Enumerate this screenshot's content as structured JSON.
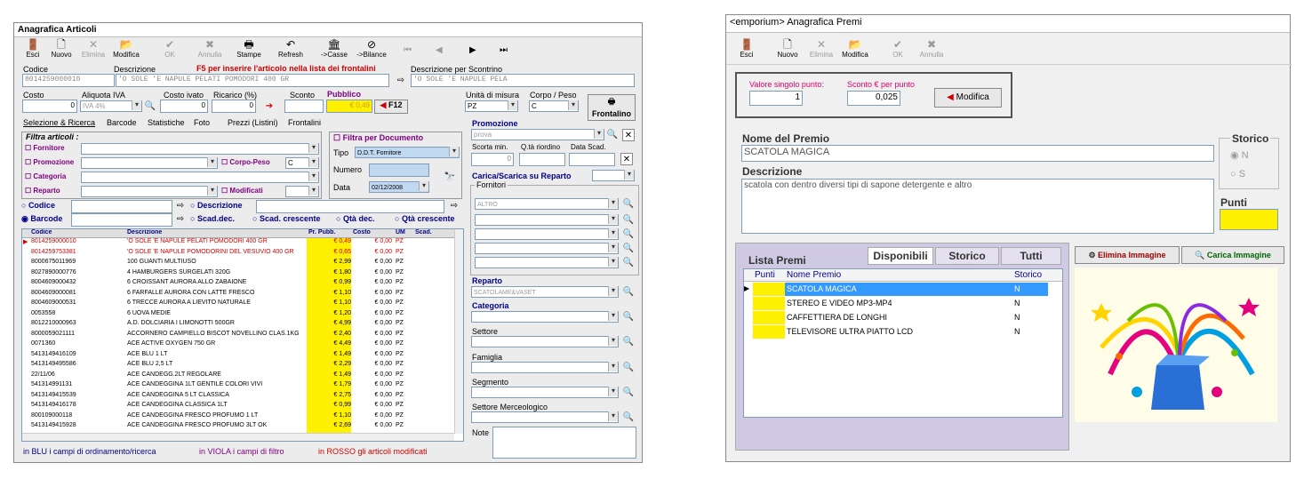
{
  "left": {
    "title": "Anagrafica Articoli",
    "toolbar": [
      "Esci",
      "Nuovo",
      "Elimina",
      "Modifica",
      "OK",
      "Annulla",
      "Stampe",
      "Refresh",
      "->Casse",
      "->Bilance"
    ],
    "codice_label": "Codice",
    "codice_value": "8014259000010",
    "descrizione_label": "Descrizione",
    "descrizione_value": "'O SOLE 'E NAPULE PELATI POMODORI 400 GR",
    "f5_hint": "F5 per inserire l'articolo nella lista dei frontalini",
    "scontrino_label": "Descrizione per Scontrino",
    "scontrino_value": "'O SOLE 'E NAPULE PELA",
    "costo_label": "Costo",
    "costo_value": "0",
    "aliquota_label": "Aliquota IVA",
    "aliquota_value": "IVA 4%",
    "costo_ivato_label": "Costo ivato",
    "costo_ivato_value": "0",
    "ricarico_label": "Ricarico (%)",
    "ricarico_value": "0",
    "sconto_label": "Sconto",
    "pubblico_label": "Pubblico",
    "pubblico_value": "€ 0,49",
    "f12": "F12",
    "unita_label": "Unità di misura",
    "unita_value": "PZ",
    "corpo_label": "Corpo / Peso",
    "corpo_value": "C",
    "frontalino": "Frontalino",
    "tabs": [
      "Selezione & Ricerca",
      "Barcode",
      "Statistiche",
      "Foto",
      "Prezzi (Listini)",
      "Frontalini"
    ],
    "filtra_title": "Filtra articoli :",
    "filters": [
      "Fornitore",
      "Promozione",
      "Categoria",
      "Reparto"
    ],
    "corpo_peso_chk": "Corpo-Peso",
    "corpo_peso_val": "C",
    "modificati_chk": "Modificati",
    "filtra_doc": "Filtra per Documento",
    "tipo_label": "Tipo",
    "tipo_value": "D.D.T. Fornitore",
    "numero_label": "Numero",
    "data_label": "Data",
    "data_value": "02/12/2008",
    "radio_codice": "Codice",
    "radio_descrizione": "Descrizione",
    "radio_barcode": "Barcode",
    "sort_options": [
      "Scad.dec.",
      "Scad. crescente",
      "Qtà dec.",
      "Qtà crescente"
    ],
    "grid_headers": [
      "Codice",
      "Descrizione",
      "Pr. Pubb.",
      "Costo",
      "UM",
      "Scad."
    ],
    "grid_rows": [
      [
        "8014259000010",
        "'O SOLE 'E NAPULE PELATI POMODORI 400 GR",
        "€ 0,49",
        "€ 0,00",
        "PZ"
      ],
      [
        "8014259753381",
        "'O SOLE 'E NAPULE POMODORINI DEL VESUVIO 400 GR",
        "€ 0,65",
        "€ 0,00",
        "PZ"
      ],
      [
        "8000675011969",
        "100 GUANTI MULTIUSO",
        "€ 2,99",
        "€ 0,00",
        "PZ"
      ],
      [
        "8027890000776",
        "4 HAMBURGERS SURGELATI 320G",
        "€ 1,80",
        "€ 0,00",
        "PZ"
      ],
      [
        "8004609000432",
        "6 CROISSANT AURORA ALLO ZABAIONE",
        "€ 0,99",
        "€ 0,00",
        "PZ"
      ],
      [
        "8004609000081",
        "6 FARFALLE AURORA CON LATTE FRESCO",
        "€ 1,10",
        "€ 0,00",
        "PZ"
      ],
      [
        "8004609000531",
        "6 TRECCE AURORA A LIEVITO NATURALE",
        "€ 1,10",
        "€ 0,00",
        "PZ"
      ],
      [
        "0053558",
        "6 UOVA MEDIE",
        "€ 1,20",
        "€ 0,00",
        "PZ"
      ],
      [
        "8012210000963",
        "A.D. DOLCIARIA I LIMONOTTI 500GR",
        "€ 4,99",
        "€ 0,00",
        "PZ"
      ],
      [
        "8000059021111",
        "ACCORNERO CAMPIELLO BISCOT NOVELLINO CLAS.1KG",
        "€ 2,40",
        "€ 0,00",
        "PZ"
      ],
      [
        "0071360",
        "ACE ACTIVE OXYGEN 750 GR",
        "€ 4,49",
        "€ 0,00",
        "PZ"
      ],
      [
        "5413149416109",
        "ACE BLU 1 LT",
        "€ 1,49",
        "€ 0,00",
        "PZ"
      ],
      [
        "5413149495586",
        "ACE BLU 2,5 LT",
        "€ 2,29",
        "€ 0,00",
        "PZ"
      ],
      [
        "22/11/06",
        "ACE CANDEGG.2LT REGOLARE",
        "€ 1,49",
        "€ 0,00",
        "PZ"
      ],
      [
        "541314991131",
        "ACE CANDEGGINA 1LT GENTILE COLORI VIVI",
        "€ 1,79",
        "€ 0,00",
        "PZ"
      ],
      [
        "5413149415539",
        "ACE CANDEGGINA 5 LT CLASSICA",
        "€ 2,75",
        "€ 0,00",
        "PZ"
      ],
      [
        "5413149416178",
        "ACE CANDEGGINA CLASSICA 1LT",
        "€ 0,99",
        "€ 0,00",
        "PZ"
      ],
      [
        "800109000118",
        "ACE CANDEGGINA FRESCO PROFUMO 1 LT",
        "€ 1,10",
        "€ 0,00",
        "PZ"
      ],
      [
        "5413149415928",
        "ACE CANDEGGINA FRESCO PROFUMO 3LT OK",
        "€ 2,69",
        "€ 0,00",
        "PZ"
      ]
    ],
    "promozione_label": "Promozione",
    "promozione_value": "prova",
    "scorta_label": "Scorta min.",
    "qta_label": "Q.tà riordino",
    "data_scad_label": "Data Scad.",
    "scorta_value": "0",
    "carica_label": "Carica/Scarica su Reparto",
    "fornitori_label": "Fornitori",
    "fornitore1": "ALTRO",
    "reparto_label": "Reparto",
    "reparto_value": "SCATOLAME&VASET",
    "categoria_label": "Categoria",
    "settore_label": "Settore",
    "famiglia_label": "Famiglia",
    "segmento_label": "Segmento",
    "settore_merc_label": "Settore Merceologico",
    "note_label": "Note",
    "footer_blue": "in BLU i campi di ordinamento/ricerca",
    "footer_purple": "in VIOLA i campi di filtro",
    "footer_red": "in ROSSO gli articoli modificati"
  },
  "right": {
    "title": "<emporium> Anagrafica Premi",
    "toolbar": [
      "Esci",
      "Nuovo",
      "Elimina",
      "Modifica",
      "OK",
      "Annulla"
    ],
    "valore_label": "Valore singolo punto:",
    "valore_value": "1",
    "sconto_label": "Sconto € per punto",
    "sconto_value": "0,025",
    "modifica_btn": "Modifica",
    "nome_label": "Nome del Premio",
    "nome_value": "SCATOLA MAGICA",
    "descrizione_label": "Descrizione",
    "descrizione_value": "scatola con dentro diversi tipi di sapone detergente e altro",
    "storico_label": "Storico",
    "storico_n": "N",
    "storico_s": "S",
    "punti_label": "Punti",
    "lista_label": "Lista Premi",
    "tabs": [
      "Disponibili",
      "Storico",
      "Tutti"
    ],
    "elimina_img": "Elimina Immagine",
    "carica_img": "Carica Immagine",
    "grid_headers": [
      "Punti",
      "Nome Premio",
      "Storico"
    ],
    "grid_rows": [
      [
        "SCATOLA MAGICA",
        "N"
      ],
      [
        "STEREO E VIDEO MP3-MP4",
        "N"
      ],
      [
        "CAFFETTIERA DE LONGHI",
        "N"
      ],
      [
        "TELEVISORE ULTRA PIATTO LCD",
        "N"
      ]
    ]
  }
}
